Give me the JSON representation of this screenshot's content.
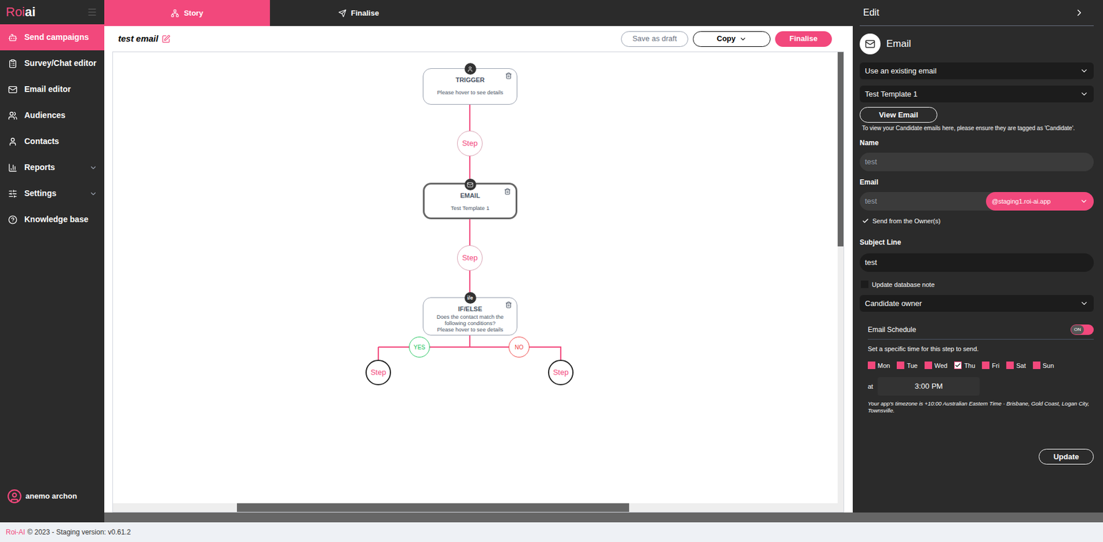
{
  "sidebar": {
    "logo": {
      "primary": "Roi",
      "secondary": "ai"
    },
    "items": [
      {
        "label": "Send campaigns",
        "selected": true,
        "has_submenu": false
      },
      {
        "label": "Survey/Chat editor",
        "selected": false,
        "has_submenu": false
      },
      {
        "label": "Email editor",
        "selected": false,
        "has_submenu": false
      },
      {
        "label": "Audiences",
        "selected": false,
        "has_submenu": false
      },
      {
        "label": "Contacts",
        "selected": false,
        "has_submenu": false
      },
      {
        "label": "Reports",
        "selected": false,
        "has_submenu": true
      },
      {
        "label": "Settings",
        "selected": false,
        "has_submenu": true
      },
      {
        "label": "Knowledge base",
        "selected": false,
        "has_submenu": false
      }
    ],
    "user": {
      "name": "anemo archon"
    }
  },
  "tabs": [
    {
      "label": "Story",
      "selected": true
    },
    {
      "label": "Finalise",
      "selected": false
    }
  ],
  "header": {
    "title": "test email",
    "buttons": [
      {
        "label": "Save as draft",
        "kind": "outline"
      },
      {
        "label": "Copy",
        "kind": "dropdown"
      },
      {
        "label": "Finalise",
        "kind": "primary"
      }
    ]
  },
  "canvas": {
    "nodes": [
      {
        "kind": "trigger",
        "title": "TRIGGER",
        "lines": [
          "Please hover to see details"
        ],
        "selected": false
      },
      {
        "kind": "email",
        "title": "EMAIL",
        "lines": [
          "Test Template 1"
        ],
        "selected": true
      },
      {
        "kind": "condition",
        "badge": "i/e",
        "title": "IF/ELSE",
        "lines": [
          "Does the contact match the following conditions?",
          "Please hover to see details"
        ],
        "selected": false
      }
    ],
    "steps": [
      {
        "label": "Step",
        "kind": "main"
      },
      {
        "label": "Step",
        "kind": "main"
      },
      {
        "label": "Step",
        "kind": "branch"
      },
      {
        "label": "Step",
        "kind": "branch"
      }
    ],
    "branches": [
      {
        "label": "YES",
        "color": "#22c55e"
      },
      {
        "label": "NO",
        "color": "#ef4444"
      }
    ]
  },
  "panel": {
    "title": "Edit",
    "section": "Email",
    "source": "Use an existing email",
    "template": "Test Template 1",
    "view_button": "View Email",
    "info": "To view your Candidate emails here, please ensure they are tagged as 'Candidate'.",
    "name": {
      "label": "Name",
      "value": "test"
    },
    "email": {
      "label": "Email",
      "value": "test",
      "domain": "@staging1.roi-ai.app"
    },
    "send_from_owner": {
      "label": "Send from the Owner(s)",
      "checked": true
    },
    "subject": {
      "label": "Subject Line",
      "value": "test"
    },
    "update_note": {
      "label": "Update database note",
      "checked": false
    },
    "owner": "Candidate owner",
    "schedule": {
      "label": "Email Schedule",
      "on": true,
      "toggle_text": "ON",
      "hint": "Set a specific time for this step to send.",
      "days": [
        {
          "label": "Mon",
          "checked": false
        },
        {
          "label": "Tue",
          "checked": false
        },
        {
          "label": "Wed",
          "checked": false
        },
        {
          "label": "Thu",
          "checked": true
        },
        {
          "label": "Fri",
          "checked": false
        },
        {
          "label": "Sat",
          "checked": false
        },
        {
          "label": "Sun",
          "checked": false
        }
      ],
      "at_label": "at",
      "time": "3:00 PM",
      "timezone": "Your app's timezone is +10:00 Australian Eastern Time - Brisbane, Gold Coast, Logan City, Townsville."
    },
    "update_button": "Update"
  },
  "footer": {
    "brand": "Roi-AI",
    "text": "© 2023 - Staging version: v0.61.2"
  }
}
